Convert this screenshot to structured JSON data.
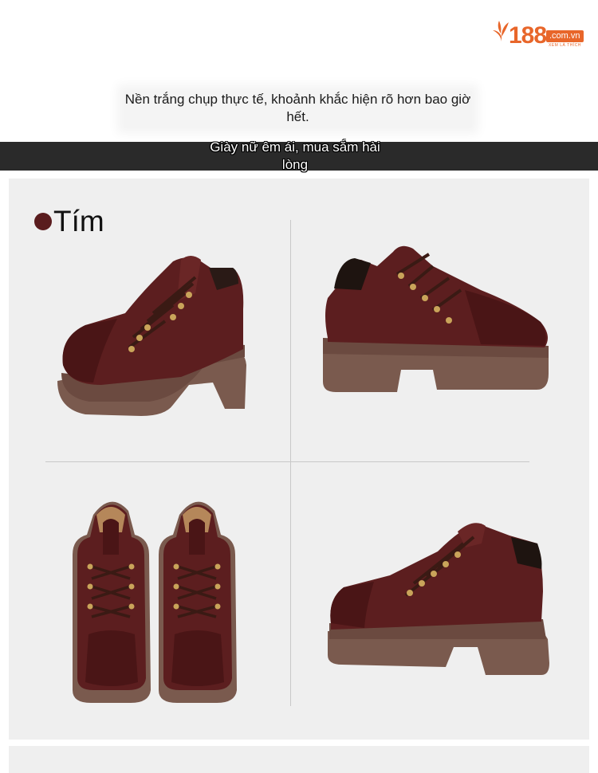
{
  "logo": {
    "number": "188",
    "domain": ".com.vn",
    "tagline": "XEM LÀ THÍCH",
    "brand_color": "#e8662a"
  },
  "captions": {
    "line1": "Nền trắng chụp thực tế, khoảnh khắc hiện rõ hơn bao giờ hết.",
    "line2": "Giày nữ êm ái, mua sắm hài lòng"
  },
  "product": {
    "color_name": "Tím",
    "color_swatch": "#5a1c1e",
    "shoe_color": "#5c1e1f",
    "sole_color": "#7a5a4e"
  },
  "gallery": {
    "views": [
      "three-quarter-left",
      "side-right",
      "front-pair",
      "three-quarter-right"
    ]
  }
}
